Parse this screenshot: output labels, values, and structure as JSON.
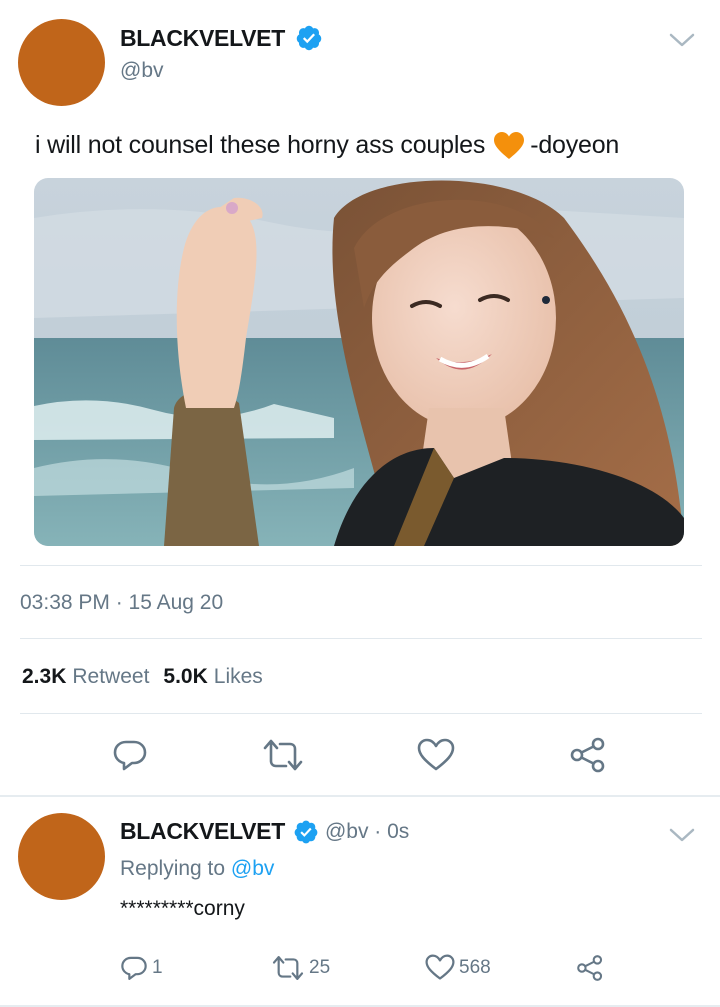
{
  "colors": {
    "avatar": "#c0651a",
    "verified": "#1da1f2",
    "secondary_text": "#657786",
    "link": "#1da1f2",
    "orange_heart": "#f4900c"
  },
  "tweet": {
    "author": {
      "display_name": "BLACKVELVET",
      "handle": "@bv",
      "verified_icon": "verified-badge-icon"
    },
    "text_before": "i will not counsel these horny ass couples",
    "emoji": "orange-heart-emoji",
    "text_after": "-doyeon",
    "media": {
      "description_icon": "photo"
    },
    "timestamp": "03:38 PM · 15 Aug 20",
    "stats": {
      "retweets_count": "2.3K",
      "retweets_label": "Retweet",
      "likes_count": "5.0K",
      "likes_label": "Likes"
    },
    "actions": [
      {
        "icon": "reply-icon"
      },
      {
        "icon": "retweet-icon"
      },
      {
        "icon": "like-icon"
      },
      {
        "icon": "share-icon"
      }
    ]
  },
  "reply": {
    "author": {
      "display_name": "BLACKVELVET",
      "handle_time": "@bv · 0s"
    },
    "replying_to_label": "Replying to",
    "replying_to_mention": "@bv",
    "text": "*********corny",
    "actions": {
      "reply_count": "1",
      "retweet_count": "25",
      "like_count": "568",
      "share_count": ""
    }
  }
}
